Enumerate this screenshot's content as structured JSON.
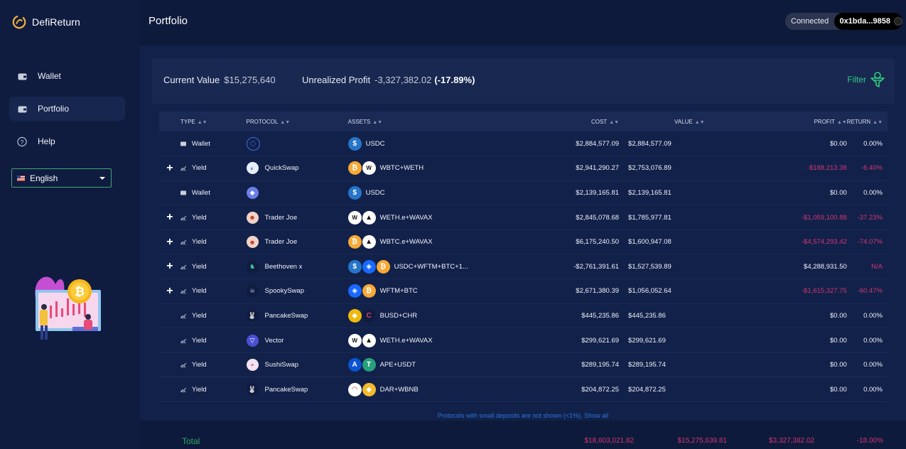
{
  "app": {
    "name": "DefiReturn"
  },
  "header": {
    "title": "Portfolio",
    "connection_status": "Connected",
    "wallet_address": "0x1bda...9858"
  },
  "sidebar": {
    "items": [
      {
        "label": "Wallet",
        "icon": "wallet-icon"
      },
      {
        "label": "Portfolio",
        "icon": "portfolio-icon",
        "active": true
      },
      {
        "label": "Help",
        "icon": "help-icon"
      }
    ],
    "language": "English"
  },
  "summary": {
    "current_value_label": "Current Value",
    "current_value": "$15,275,640",
    "unrealized_profit_label": "Unrealized Profit",
    "unrealized_profit": "-3,327,382.02",
    "unrealized_profit_pct": "(-17.89%)",
    "filter_label": "Filter"
  },
  "table": {
    "headers": {
      "type": "TYPE",
      "protocol": "PROTOCOL",
      "assets": "ASSETS",
      "cost": "COST",
      "value": "VALUE",
      "profit": "PROFIT",
      "return": "RETURN"
    },
    "rows": [
      {
        "expandable": false,
        "type": "Wallet",
        "protocol": "",
        "protocol_icon": "polygon-icon",
        "assets": "USDC",
        "asset_icons": [
          "usdc-icon"
        ],
        "cost": "$2,884,577.09",
        "value": "$2,884,577.09",
        "profit": "$0.00",
        "return": "0.00%",
        "negative": false
      },
      {
        "expandable": true,
        "type": "Yield",
        "protocol": "QuickSwap",
        "protocol_icon": "quickswap-icon",
        "assets": "WBTC+WETH",
        "asset_icons": [
          "wbtc-icon",
          "weth-icon"
        ],
        "cost": "$2,941,290.27",
        "value": "$2,753,076.89",
        "profit": "-$188,213.38",
        "return": "-6.40%",
        "negative": true
      },
      {
        "expandable": false,
        "type": "Wallet",
        "protocol": "",
        "protocol_icon": "ethereum-icon",
        "assets": "USDC",
        "asset_icons": [
          "usdc-icon"
        ],
        "cost": "$2,139,165.81",
        "value": "$2,139,165.81",
        "profit": "$0.00",
        "return": "0.00%",
        "negative": false
      },
      {
        "expandable": true,
        "type": "Yield",
        "protocol": "Trader Joe",
        "protocol_icon": "traderjoe-icon",
        "assets": "WETH.e+WAVAX",
        "asset_icons": [
          "weth-icon",
          "avax-icon"
        ],
        "cost": "$2,845,078.68",
        "value": "$1,785,977.81",
        "profit": "-$1,059,100.88",
        "return": "-37.23%",
        "negative": true
      },
      {
        "expandable": true,
        "type": "Yield",
        "protocol": "Trader Joe",
        "protocol_icon": "traderjoe-icon",
        "assets": "WBTC.e+WAVAX",
        "asset_icons": [
          "wbtc-icon",
          "avax-icon"
        ],
        "cost": "$6,175,240.50",
        "value": "$1,600,947.08",
        "profit": "-$4,574,293.42",
        "return": "-74.07%",
        "negative": true
      },
      {
        "expandable": true,
        "type": "Yield",
        "protocol": "Beethoven x",
        "protocol_icon": "beethoven-icon",
        "assets": "USDC+WFTM+BTC+1...",
        "asset_icons": [
          "usdc-icon",
          "fantom-icon",
          "btc-icon"
        ],
        "cost": "-$2,761,391.61",
        "value": "$1,527,539.89",
        "profit": "$4,288,931.50",
        "return": "N/A",
        "negative": false,
        "return_na": true
      },
      {
        "expandable": true,
        "type": "Yield",
        "protocol": "SpookySwap",
        "protocol_icon": "spookyswap-icon",
        "assets": "WFTM+BTC",
        "asset_icons": [
          "fantom-icon",
          "btc-icon"
        ],
        "cost": "$2,671,380.39",
        "value": "$1,056,052.64",
        "profit": "-$1,615,327.75",
        "return": "-60.47%",
        "negative": true
      },
      {
        "expandable": false,
        "type": "Yield",
        "protocol": "PancakeSwap",
        "protocol_icon": "pancakeswap-icon",
        "assets": "BUSD+CHR",
        "asset_icons": [
          "busd-icon",
          "chr-icon"
        ],
        "cost": "$445,235.86",
        "value": "$445,235.86",
        "profit": "$0.00",
        "return": "0.00%",
        "negative": false
      },
      {
        "expandable": false,
        "type": "Yield",
        "protocol": "Vector",
        "protocol_icon": "vector-icon",
        "assets": "WETH.e+WAVAX",
        "asset_icons": [
          "weth-icon",
          "avax-icon"
        ],
        "cost": "$299,621.69",
        "value": "$299,621.69",
        "profit": "$0.00",
        "return": "0.00%",
        "negative": false
      },
      {
        "expandable": false,
        "type": "Yield",
        "protocol": "SushiSwap",
        "protocol_icon": "sushiswap-icon",
        "assets": "APE+USDT",
        "asset_icons": [
          "ape-icon",
          "usdt-icon"
        ],
        "cost": "$289,195.74",
        "value": "$289,195.74",
        "profit": "$0.00",
        "return": "0.00%",
        "negative": false
      },
      {
        "expandable": false,
        "type": "Yield",
        "protocol": "PancakeSwap",
        "protocol_icon": "pancakeswap-icon",
        "assets": "DAR+WBNB",
        "asset_icons": [
          "dar-icon",
          "bnb-icon"
        ],
        "cost": "$204,872.25",
        "value": "$204,872.25",
        "profit": "$0.00",
        "return": "0.00%",
        "negative": false
      }
    ],
    "note": "Protocols with small deposits are not shown (<1%). Show all"
  },
  "total": {
    "label": "Total",
    "cost": "$18,603,021.82",
    "value": "$15,275,639.81",
    "profit": "$3,327,382.02",
    "return": "-18.00%"
  },
  "colors": {
    "accent_green": "#2fcf7e",
    "negative": "#d2376f",
    "link_blue": "#2b75d6"
  }
}
